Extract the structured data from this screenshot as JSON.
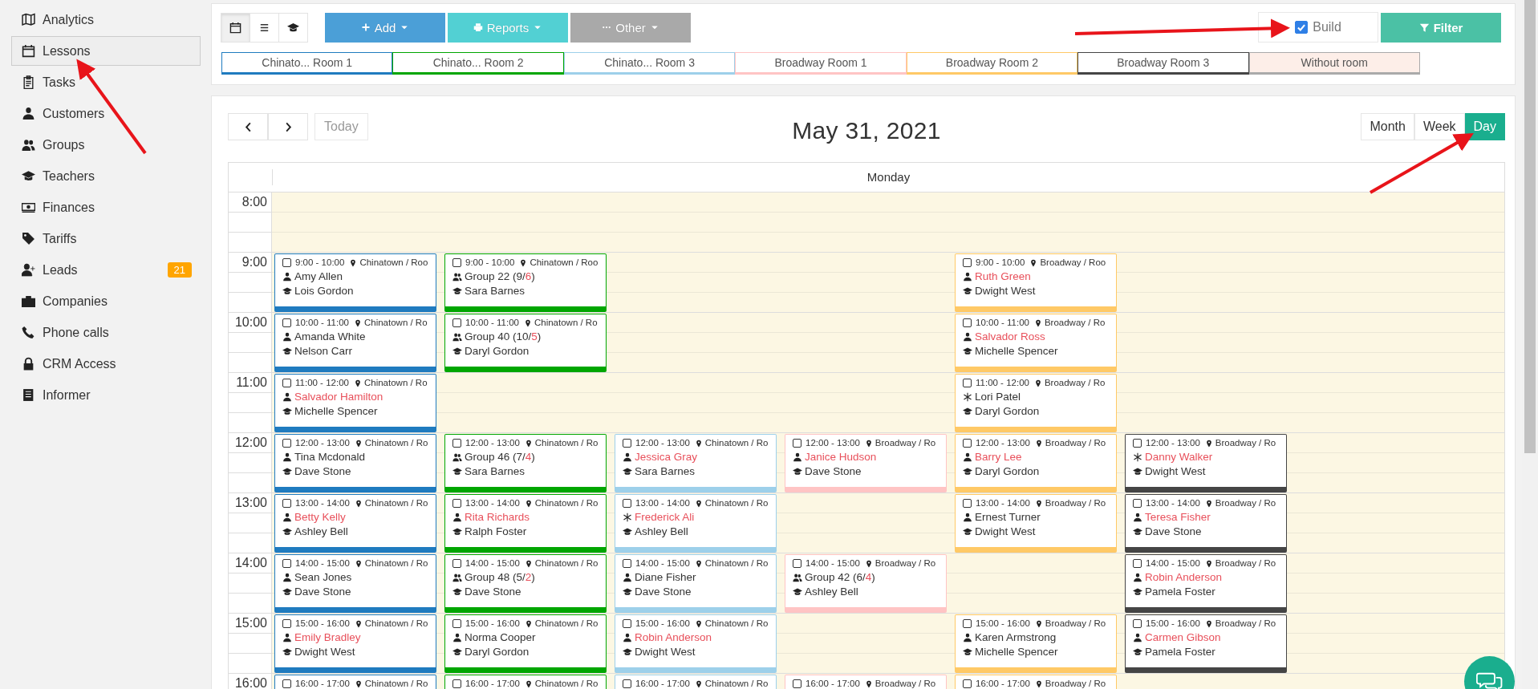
{
  "sidebar": {
    "items": [
      {
        "label": "Analytics",
        "selected": false
      },
      {
        "label": "Lessons",
        "selected": true
      },
      {
        "label": "Tasks",
        "selected": false
      },
      {
        "label": "Customers",
        "selected": false
      },
      {
        "label": "Groups",
        "selected": false
      },
      {
        "label": "Teachers",
        "selected": false
      },
      {
        "label": "Finances",
        "selected": false
      },
      {
        "label": "Tariffs",
        "selected": false
      },
      {
        "label": "Leads",
        "selected": false,
        "badge": "21"
      },
      {
        "label": "Companies",
        "selected": false
      },
      {
        "label": "Phone calls",
        "selected": false
      },
      {
        "label": "CRM Access",
        "selected": false
      },
      {
        "label": "Informer",
        "selected": false
      }
    ]
  },
  "toolbar": {
    "views": [
      {
        "selected": true
      },
      {
        "selected": false
      },
      {
        "selected": false
      }
    ],
    "actions": [
      {
        "label": "Add",
        "color": "#4b9fd7"
      },
      {
        "label": "Reports",
        "color": "#52d0d3"
      },
      {
        "label": "Other",
        "color": "#a9a9a9"
      }
    ],
    "build": {
      "label": "Build",
      "checked": true
    },
    "filter": {
      "label": "Filter"
    }
  },
  "rooms": [
    {
      "label": "Chinato... Room 1",
      "color": "#1f7bbf"
    },
    {
      "label": "Chinato... Room 2",
      "color": "#00a600"
    },
    {
      "label": "Chinato... Room 3",
      "color": "#9dd0ea"
    },
    {
      "label": "Broadway Room 1",
      "color": "#ffc4c4"
    },
    {
      "label": "Broadway Room 2",
      "color": "#ffc966"
    },
    {
      "label": "Broadway Room 3",
      "color": "#454545"
    },
    {
      "label": "Without room",
      "color": "#aaaaaa",
      "kind": "unassigned"
    }
  ],
  "calendar": {
    "today": {
      "label": "Today",
      "disabled": true
    },
    "title": "May 31, 2021",
    "views": [
      {
        "label": "Month",
        "selected": false
      },
      {
        "label": "Week",
        "selected": false
      },
      {
        "label": "Day",
        "selected": true
      }
    ],
    "day": "Monday",
    "rows": [
      {
        "time": "8:00"
      },
      {
        "time": "9:00",
        "slots": [
          {
            "kind": "lesson",
            "checked": false,
            "time": "9:00 - 10:00",
            "location": "Chinatown / Roo",
            "client": {
              "kind": "person",
              "parts": [
                {
                  "text": "Amy Allen",
                  "alert": false
                }
              ]
            },
            "teacher": "Lois Gordon"
          },
          {
            "kind": "lesson",
            "checked": false,
            "time": "9:00 - 10:00",
            "location": "Chinatown / Roo",
            "client": {
              "kind": "group",
              "parts": [
                {
                  "text": "Group 22 (9/",
                  "alert": false
                },
                {
                  "text": "6",
                  "alert": true
                },
                {
                  "text": ")",
                  "alert": false
                }
              ]
            },
            "teacher": "Sara Barnes"
          },
          {
            "kind": "empty"
          },
          {
            "kind": "empty"
          },
          {
            "kind": "lesson",
            "checked": false,
            "time": "9:00 - 10:00",
            "location": "Broadway / Roo",
            "client": {
              "kind": "person",
              "parts": [
                {
                  "text": "Ruth Green",
                  "alert": true
                }
              ]
            },
            "teacher": "Dwight West"
          },
          {
            "kind": "empty"
          }
        ]
      },
      {
        "time": "10:00",
        "slots": [
          {
            "kind": "lesson",
            "checked": false,
            "time": "10:00 - 11:00",
            "location": "Chinatown / Ro",
            "client": {
              "kind": "person",
              "parts": [
                {
                  "text": "Amanda White",
                  "alert": false
                }
              ]
            },
            "teacher": "Nelson Carr"
          },
          {
            "kind": "lesson",
            "checked": false,
            "time": "10:00 - 11:00",
            "location": "Chinatown / Ro",
            "client": {
              "kind": "group",
              "parts": [
                {
                  "text": "Group 40 (10/",
                  "alert": false
                },
                {
                  "text": "5",
                  "alert": true
                },
                {
                  "text": ")",
                  "alert": false
                }
              ]
            },
            "teacher": "Daryl Gordon"
          },
          {
            "kind": "empty"
          },
          {
            "kind": "empty"
          },
          {
            "kind": "lesson",
            "checked": false,
            "time": "10:00 - 11:00",
            "location": "Broadway / Ro",
            "client": {
              "kind": "person",
              "parts": [
                {
                  "text": "Salvador Ross",
                  "alert": true
                }
              ]
            },
            "teacher": "Michelle Spencer"
          },
          {
            "kind": "empty"
          }
        ]
      },
      {
        "time": "11:00",
        "slots": [
          {
            "kind": "lesson",
            "checked": false,
            "time": "11:00 - 12:00",
            "location": "Chinatown / Ro",
            "client": {
              "kind": "person",
              "parts": [
                {
                  "text": "Salvador Hamilton",
                  "alert": true
                }
              ]
            },
            "teacher": "Michelle Spencer"
          },
          {
            "kind": "empty"
          },
          {
            "kind": "empty"
          },
          {
            "kind": "empty"
          },
          {
            "kind": "lesson",
            "checked": false,
            "time": "11:00 - 12:00",
            "location": "Broadway / Ro",
            "client": {
              "kind": "other",
              "parts": [
                {
                  "text": "Lori Patel",
                  "alert": false
                }
              ]
            },
            "teacher": "Daryl Gordon"
          },
          {
            "kind": "empty"
          }
        ]
      },
      {
        "time": "12:00",
        "slots": [
          {
            "kind": "lesson",
            "checked": false,
            "time": "12:00 - 13:00",
            "location": "Chinatown / Ro",
            "client": {
              "kind": "person",
              "parts": [
                {
                  "text": "Tina Mcdonald",
                  "alert": false
                }
              ]
            },
            "teacher": "Dave Stone"
          },
          {
            "kind": "lesson",
            "checked": false,
            "time": "12:00 - 13:00",
            "location": "Chinatown / Ro",
            "client": {
              "kind": "group",
              "parts": [
                {
                  "text": "Group 46 (7/",
                  "alert": false
                },
                {
                  "text": "4",
                  "alert": true
                },
                {
                  "text": ")",
                  "alert": false
                }
              ]
            },
            "teacher": "Sara Barnes"
          },
          {
            "kind": "lesson",
            "checked": false,
            "time": "12:00 - 13:00",
            "location": "Chinatown / Ro",
            "client": {
              "kind": "person",
              "parts": [
                {
                  "text": "Jessica Gray",
                  "alert": true
                }
              ]
            },
            "teacher": "Sara Barnes"
          },
          {
            "kind": "lesson",
            "checked": false,
            "time": "12:00 - 13:00",
            "location": "Broadway / Ro",
            "client": {
              "kind": "person",
              "parts": [
                {
                  "text": "Janice Hudson",
                  "alert": true
                }
              ]
            },
            "teacher": "Dave Stone"
          },
          {
            "kind": "lesson",
            "checked": false,
            "time": "12:00 - 13:00",
            "location": "Broadway / Ro",
            "client": {
              "kind": "person",
              "parts": [
                {
                  "text": "Barry Lee",
                  "alert": true
                }
              ]
            },
            "teacher": "Daryl Gordon"
          },
          {
            "kind": "lesson",
            "checked": false,
            "time": "12:00 - 13:00",
            "location": "Broadway / Ro",
            "client": {
              "kind": "other",
              "parts": [
                {
                  "text": "Danny Walker",
                  "alert": true
                }
              ]
            },
            "teacher": "Dwight West"
          }
        ]
      },
      {
        "time": "13:00",
        "slots": [
          {
            "kind": "lesson",
            "checked": false,
            "time": "13:00 - 14:00",
            "location": "Chinatown / Ro",
            "client": {
              "kind": "person",
              "parts": [
                {
                  "text": "Betty Kelly",
                  "alert": true
                }
              ]
            },
            "teacher": "Ashley Bell"
          },
          {
            "kind": "lesson",
            "checked": false,
            "time": "13:00 - 14:00",
            "location": "Chinatown / Ro",
            "client": {
              "kind": "person",
              "parts": [
                {
                  "text": "Rita Richards",
                  "alert": true
                }
              ]
            },
            "teacher": "Ralph Foster"
          },
          {
            "kind": "lesson",
            "checked": false,
            "time": "13:00 - 14:00",
            "location": "Chinatown / Ro",
            "client": {
              "kind": "other",
              "parts": [
                {
                  "text": "Frederick Ali",
                  "alert": true
                }
              ]
            },
            "teacher": "Ashley Bell"
          },
          {
            "kind": "empty"
          },
          {
            "kind": "lesson",
            "checked": false,
            "time": "13:00 - 14:00",
            "location": "Broadway / Ro",
            "client": {
              "kind": "person",
              "parts": [
                {
                  "text": "Ernest Turner",
                  "alert": false
                }
              ]
            },
            "teacher": "Dwight West"
          },
          {
            "kind": "lesson",
            "checked": false,
            "time": "13:00 - 14:00",
            "location": "Broadway / Ro",
            "client": {
              "kind": "person",
              "parts": [
                {
                  "text": "Teresa Fisher",
                  "alert": true
                }
              ]
            },
            "teacher": "Dave Stone"
          }
        ]
      },
      {
        "time": "14:00",
        "slots": [
          {
            "kind": "lesson",
            "checked": false,
            "time": "14:00 - 15:00",
            "location": "Chinatown / Ro",
            "client": {
              "kind": "person",
              "parts": [
                {
                  "text": "Sean Jones",
                  "alert": false
                }
              ]
            },
            "teacher": "Dave Stone"
          },
          {
            "kind": "lesson",
            "checked": false,
            "time": "14:00 - 15:00",
            "location": "Chinatown / Ro",
            "client": {
              "kind": "group",
              "parts": [
                {
                  "text": "Group 48 (5/",
                  "alert": false
                },
                {
                  "text": "2",
                  "alert": true
                },
                {
                  "text": ")",
                  "alert": false
                }
              ]
            },
            "teacher": "Dave Stone"
          },
          {
            "kind": "lesson",
            "checked": false,
            "time": "14:00 - 15:00",
            "location": "Chinatown / Ro",
            "client": {
              "kind": "person",
              "parts": [
                {
                  "text": "Diane Fisher",
                  "alert": false
                }
              ]
            },
            "teacher": "Dave Stone"
          },
          {
            "kind": "lesson",
            "checked": false,
            "time": "14:00 - 15:00",
            "location": "Broadway / Ro",
            "client": {
              "kind": "group",
              "parts": [
                {
                  "text": "Group 42 (6/",
                  "alert": false
                },
                {
                  "text": "4",
                  "alert": true
                },
                {
                  "text": ")",
                  "alert": false
                }
              ]
            },
            "teacher": "Ashley Bell"
          },
          {
            "kind": "empty"
          },
          {
            "kind": "lesson",
            "checked": false,
            "time": "14:00 - 15:00",
            "location": "Broadway / Ro",
            "client": {
              "kind": "person",
              "parts": [
                {
                  "text": "Robin Anderson",
                  "alert": true
                }
              ]
            },
            "teacher": "Pamela Foster"
          }
        ]
      },
      {
        "time": "15:00",
        "slots": [
          {
            "kind": "lesson",
            "checked": false,
            "time": "15:00 - 16:00",
            "location": "Chinatown / Ro",
            "client": {
              "kind": "person",
              "parts": [
                {
                  "text": "Emily Bradley",
                  "alert": true
                }
              ]
            },
            "teacher": "Dwight West"
          },
          {
            "kind": "lesson",
            "checked": false,
            "time": "15:00 - 16:00",
            "location": "Chinatown / Ro",
            "client": {
              "kind": "person",
              "parts": [
                {
                  "text": "Norma Cooper",
                  "alert": false
                }
              ]
            },
            "teacher": "Daryl Gordon"
          },
          {
            "kind": "lesson",
            "checked": false,
            "time": "15:00 - 16:00",
            "location": "Chinatown / Ro",
            "client": {
              "kind": "person",
              "parts": [
                {
                  "text": "Robin Anderson",
                  "alert": true
                }
              ]
            },
            "teacher": "Dwight West"
          },
          {
            "kind": "empty"
          },
          {
            "kind": "lesson",
            "checked": false,
            "time": "15:00 - 16:00",
            "location": "Broadway / Ro",
            "client": {
              "kind": "person",
              "parts": [
                {
                  "text": "Karen Armstrong",
                  "alert": false
                }
              ]
            },
            "teacher": "Michelle Spencer"
          },
          {
            "kind": "lesson",
            "checked": false,
            "time": "15:00 - 16:00",
            "location": "Broadway / Ro",
            "client": {
              "kind": "person",
              "parts": [
                {
                  "text": "Carmen Gibson",
                  "alert": true
                }
              ]
            },
            "teacher": "Pamela Foster"
          }
        ]
      },
      {
        "time": "16:00",
        "slots": [
          {
            "kind": "partial",
            "checked": false,
            "time": "16:00 - 17:00",
            "location": "Chinatown / Ro"
          },
          {
            "kind": "partial",
            "checked": false,
            "time": "16:00 - 17:00",
            "location": "Chinatown / Ro"
          },
          {
            "kind": "partial",
            "checked": false,
            "time": "16:00 - 17:00",
            "location": "Chinatown / Ro"
          },
          {
            "kind": "partial",
            "checked": false,
            "time": "16:00 - 17:00",
            "location": "Broadway / Ro"
          },
          {
            "kind": "partial",
            "checked": false,
            "time": "16:00 - 17:00",
            "location": "Broadway / Ro"
          },
          {
            "kind": "empty"
          }
        ]
      }
    ]
  }
}
